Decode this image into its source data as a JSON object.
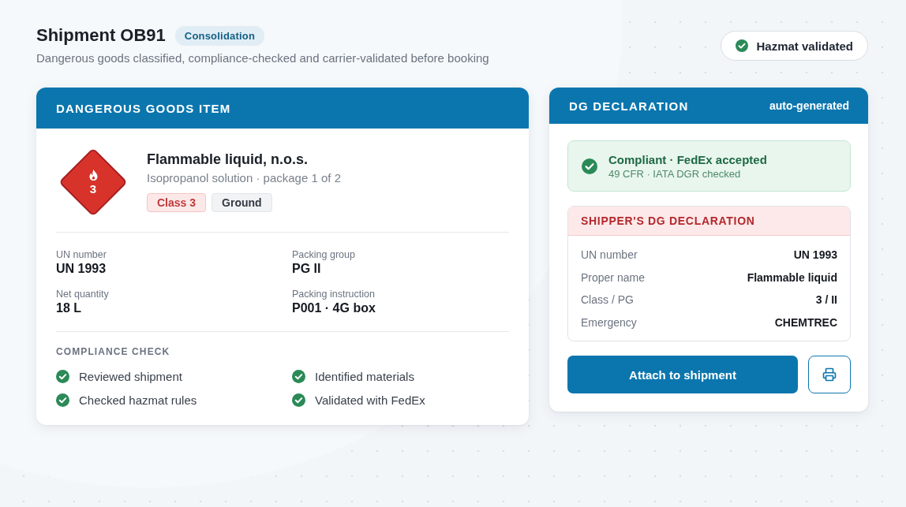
{
  "header": {
    "title": "Shipment OB91",
    "badge": "Consolidation",
    "subtitle": "Dangerous goods classified, compliance-checked and carrier-validated before booking",
    "status": "Hazmat validated"
  },
  "item_card": {
    "title": "DANGEROUS GOODS ITEM",
    "placard": {
      "class_number": "3"
    },
    "name": "Flammable liquid, n.o.s.",
    "description": "Isopropanol solution · package 1 of 2",
    "tags": [
      {
        "label": "Class 3",
        "kind": "hazard"
      },
      {
        "label": "Ground",
        "kind": "neutral"
      }
    ],
    "fields": [
      {
        "label": "UN number",
        "value": "UN 1993"
      },
      {
        "label": "Packing group",
        "value": "PG II"
      },
      {
        "label": "Net quantity",
        "value": "18 L"
      },
      {
        "label": "Packing instruction",
        "value": "P001 · 4G box"
      }
    ],
    "compliance": {
      "title": "COMPLIANCE CHECK",
      "items": [
        {
          "label": "Reviewed shipment",
          "checked": true
        },
        {
          "label": "Identified materials",
          "checked": true
        },
        {
          "label": "Checked hazmat rules",
          "checked": true
        },
        {
          "label": "Validated with FedEx",
          "checked": true
        }
      ]
    }
  },
  "declaration_card": {
    "title": "DG DECLARATION",
    "note": "auto-generated",
    "status": {
      "title": "Compliant · FedEx accepted",
      "detail": "49 CFR · IATA DGR checked"
    },
    "declaration": {
      "title": "SHIPPER'S DG DECLARATION",
      "rows": [
        {
          "label": "UN number",
          "value": "UN 1993"
        },
        {
          "label": "Proper name",
          "value": "Flammable liquid"
        },
        {
          "label": "Class / PG",
          "value": "3 / II"
        },
        {
          "label": "Emergency",
          "value": "CHEMTREC"
        }
      ]
    },
    "primary_action": "Attach to shipment"
  }
}
